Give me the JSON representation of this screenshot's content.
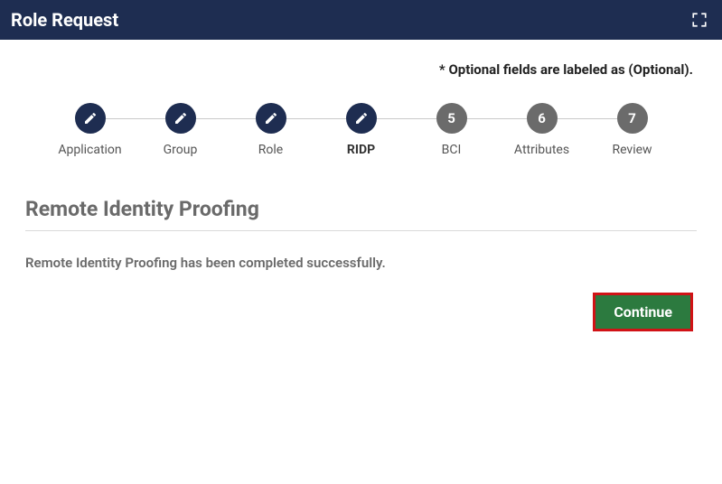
{
  "header": {
    "title": "Role Request"
  },
  "optional_note": "* Optional fields are labeled as (Optional).",
  "steps": [
    {
      "label": "Application",
      "state": "complete"
    },
    {
      "label": "Group",
      "state": "complete"
    },
    {
      "label": "Role",
      "state": "complete"
    },
    {
      "label": "RIDP",
      "state": "complete",
      "active": true
    },
    {
      "label": "BCI",
      "state": "pending",
      "number": "5"
    },
    {
      "label": "Attributes",
      "state": "pending",
      "number": "6"
    },
    {
      "label": "Review",
      "state": "pending",
      "number": "7"
    }
  ],
  "section_title": "Remote Identity Proofing",
  "message": "Remote Identity Proofing has been completed successfully.",
  "buttons": {
    "continue": "Continue"
  }
}
